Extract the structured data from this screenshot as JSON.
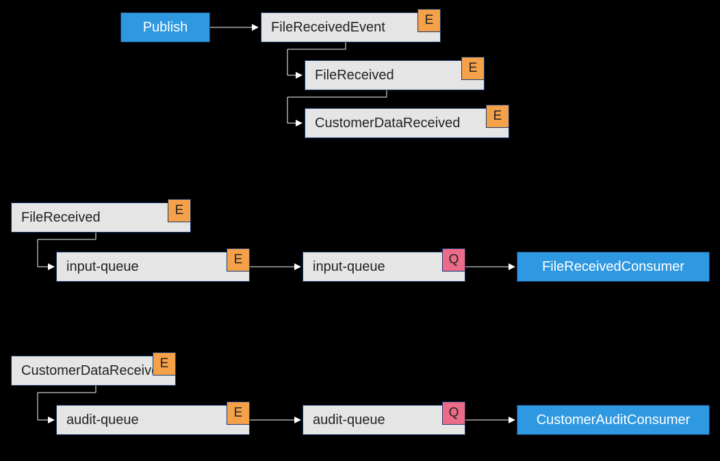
{
  "colors": {
    "background": "#000000",
    "blue": "#2e98e0",
    "grey": "#e5e5e5",
    "badge_E": "#f5a14a",
    "badge_Q": "#ed6b8a",
    "border": "#1a3a6e"
  },
  "badges": {
    "E": "E",
    "Q": "Q"
  },
  "top": {
    "publish": "Publish",
    "fileReceivedEvent": "FileReceivedEvent",
    "fileReceived": "FileReceived",
    "customerDataReceived": "CustomerDataReceived"
  },
  "mid": {
    "fileReceived": "FileReceived",
    "inputQueueLeft": "input-queue",
    "inputQueueRight": "input-queue",
    "fileReceivedConsumer": "FileReceivedConsumer"
  },
  "bot": {
    "customerDataReceived": "CustomerDataReceived",
    "auditQueueLeft": "audit-queue",
    "auditQueueRight": "audit-queue",
    "customerAuditConsumer": "CustomerAuditConsumer"
  }
}
